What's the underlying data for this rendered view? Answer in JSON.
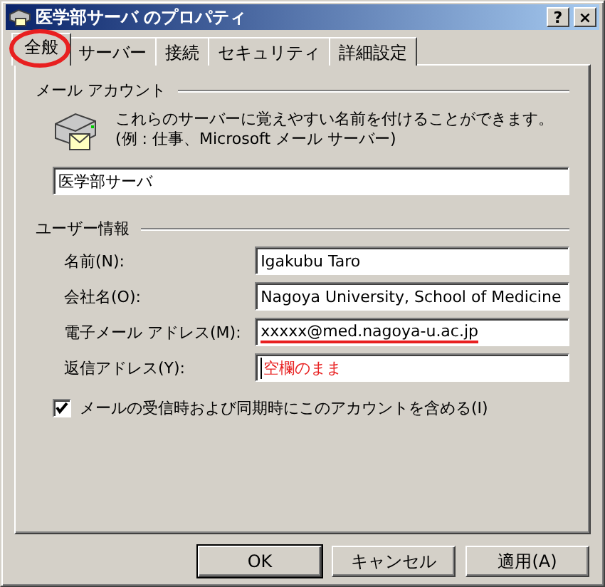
{
  "window": {
    "title": "医学部サーバ のプロパティ",
    "help_button": "?",
    "close_button": "×"
  },
  "tabs": [
    {
      "label": "全般",
      "selected": true,
      "circled": true
    },
    {
      "label": "サーバー",
      "selected": false,
      "circled": false
    },
    {
      "label": "接続",
      "selected": false,
      "circled": false
    },
    {
      "label": "セキュリティ",
      "selected": false,
      "circled": false
    },
    {
      "label": "詳細設定",
      "selected": false,
      "circled": false
    }
  ],
  "mail_account": {
    "heading": "メール アカウント",
    "description": "これらのサーバーに覚えやすい名前を付けることができます。(例 : 仕事、Microsoft メール サーバー)",
    "account_name": "医学部サーバ"
  },
  "user_info": {
    "heading": "ユーザー情報",
    "fields": [
      {
        "label": "名前(N):",
        "value": "Igakubu Taro",
        "underlined": false,
        "red_text": false
      },
      {
        "label": "会社名(O):",
        "value": "Nagoya University, School of Medicine",
        "underlined": false,
        "red_text": false
      },
      {
        "label": "電子メール アドレス(M):",
        "value": "xxxxx@med.nagoya-u.ac.jp",
        "underlined": true,
        "red_text": false
      },
      {
        "label": "返信アドレス(Y):",
        "value": "空欄のまま",
        "underlined": false,
        "red_text": true
      }
    ]
  },
  "include_account": {
    "label": "メールの受信時および同期時にこのアカウントを含める(I)",
    "checked": true
  },
  "buttons": [
    "OK",
    "キャンセル",
    "適用(A)"
  ]
}
